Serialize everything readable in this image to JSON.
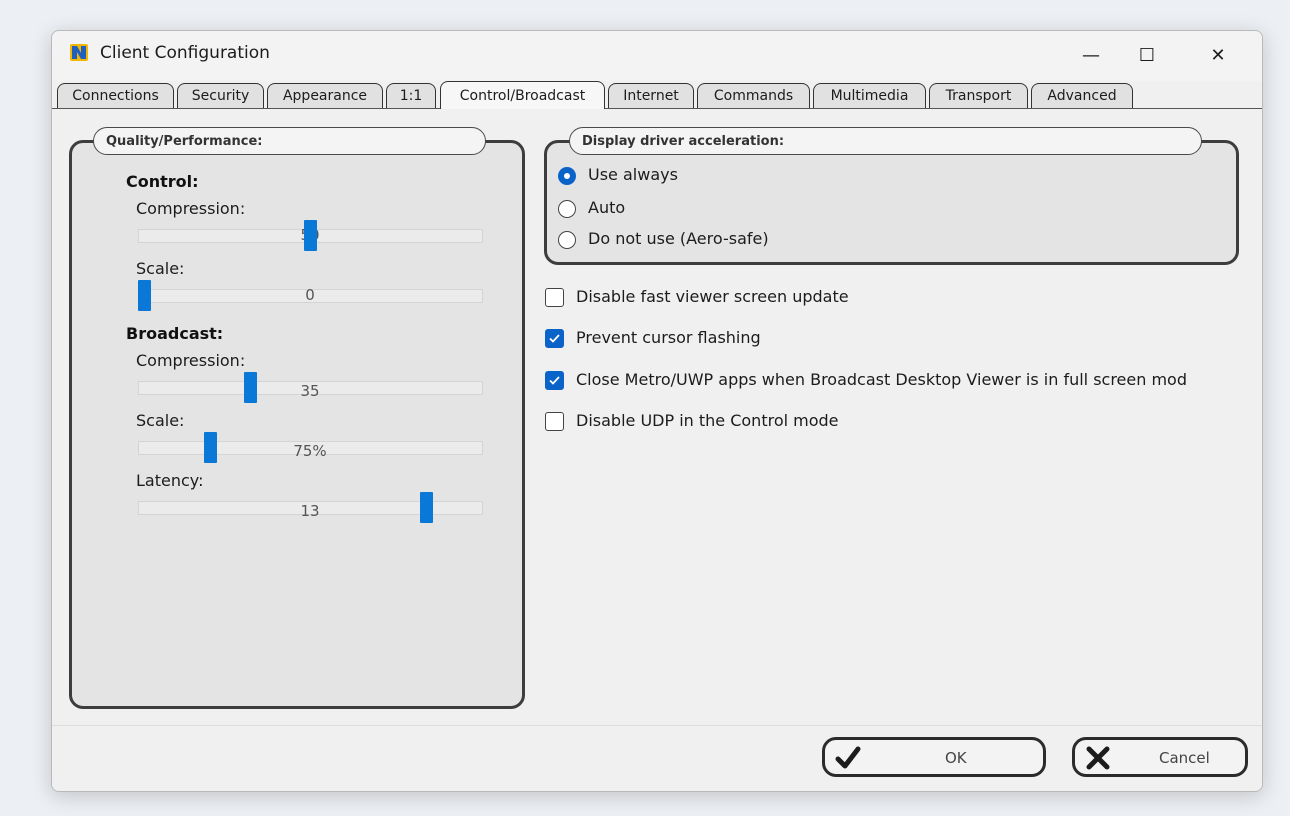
{
  "window": {
    "title": "Client Configuration"
  },
  "title_buttons": {
    "minimize": "—",
    "maximize": "☐",
    "close": "✕"
  },
  "tabs": [
    {
      "label": "Connections"
    },
    {
      "label": "Security"
    },
    {
      "label": "Appearance"
    },
    {
      "label": "1:1"
    },
    {
      "label": "Control/Broadcast",
      "active": true
    },
    {
      "label": "Internet"
    },
    {
      "label": "Commands"
    },
    {
      "label": "Multimedia"
    },
    {
      "label": "Transport"
    },
    {
      "label": "Advanced"
    }
  ],
  "quality": {
    "group_label": "Quality/Performance:",
    "control": {
      "title": "Control:",
      "compression": {
        "label": "Compression:",
        "value": "50",
        "fraction": 0.5
      },
      "scale": {
        "label": "Scale:",
        "value": "0",
        "fraction": 0.0
      }
    },
    "broadcast": {
      "title": "Broadcast:",
      "compression": {
        "label": "Compression:",
        "value": "35",
        "fraction": 0.32
      },
      "scale": {
        "label": "Scale:",
        "value": "75%",
        "fraction": 0.2
      },
      "latency": {
        "label": "Latency:",
        "value": "13",
        "fraction": 0.85
      }
    }
  },
  "display_driver": {
    "group_label": "Display driver acceleration:",
    "options": [
      {
        "label": "Use always",
        "selected": true
      },
      {
        "label": "Auto",
        "selected": false
      },
      {
        "label": "Do not use (Aero-safe)",
        "selected": false
      }
    ]
  },
  "checkboxes": [
    {
      "label": "Disable fast viewer screen update",
      "checked": false
    },
    {
      "label": "Prevent cursor flashing",
      "checked": true
    },
    {
      "label": "Close Metro/UWP apps when Broadcast Desktop Viewer is in full screen mod",
      "checked": true
    },
    {
      "label": "Disable UDP in the Control mode",
      "checked": false
    }
  ],
  "buttons": {
    "ok": "OK",
    "cancel": "Cancel"
  },
  "colors": {
    "accent": "#0a78d7",
    "radio_accent": "#0a63c9"
  }
}
